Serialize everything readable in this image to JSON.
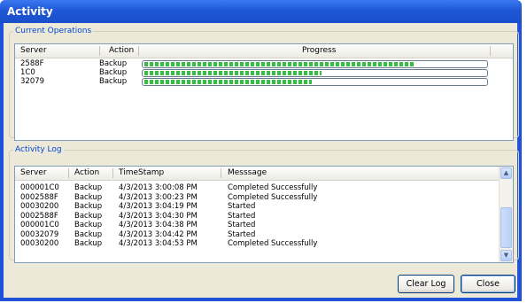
{
  "window": {
    "title": "Activity"
  },
  "current_operations": {
    "legend": "Current Operations",
    "columns": [
      "Server",
      "Action",
      "Progress"
    ],
    "rows": [
      {
        "server": "2588F",
        "action": "Backup",
        "progress": 0.79
      },
      {
        "server": "1C0",
        "action": "Backup",
        "progress": 0.52
      },
      {
        "server": "32079",
        "action": "Backup",
        "progress": 0.49
      }
    ]
  },
  "activity_log": {
    "legend": "Activity Log",
    "columns": [
      "Server",
      "Action",
      "TimeStamp",
      "Messsage"
    ],
    "rows": [
      [
        "000001C0",
        "Backup",
        "4/3/2013 3:00:08 PM",
        "Completed Successfully"
      ],
      [
        "0002588F",
        "Backup",
        "4/3/2013 3:00:23 PM",
        "Completed Successfully"
      ],
      [
        "00030200",
        "Backup",
        "4/3/2013 3:04:19 PM",
        "Started"
      ],
      [
        "0002588F",
        "Backup",
        "4/3/2013 3:04:30 PM",
        "Started"
      ],
      [
        "000001C0",
        "Backup",
        "4/3/2013 3:04:38 PM",
        "Started"
      ],
      [
        "00032079",
        "Backup",
        "4/3/2013 3:04:42 PM",
        "Started"
      ],
      [
        "00030200",
        "Backup",
        "4/3/2013 3:04:53 PM",
        "Completed Successfully"
      ]
    ]
  },
  "buttons": {
    "clear_log": "Clear Log",
    "close": "Close"
  },
  "colors": {
    "titlebar": "#1e57d6",
    "progress": "#33c03f",
    "legend": "#0046d5",
    "face": "#ece9d8"
  },
  "icons": {
    "scroll_up": "chevron-up-icon",
    "scroll_down": "chevron-down-icon"
  }
}
